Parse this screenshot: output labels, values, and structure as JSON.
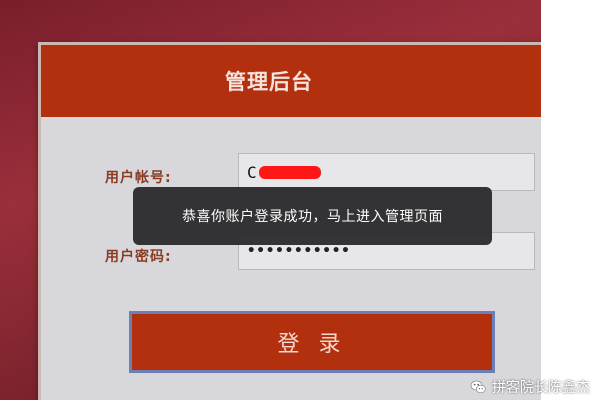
{
  "panel": {
    "title": "管理后台"
  },
  "form": {
    "account_label": "用户帐号:",
    "account_value": "C",
    "password_label": "用户密码:",
    "password_value": "•••••••••••",
    "login_label": "登 录"
  },
  "toast": {
    "message": "恭喜你账户登录成功，马上进入管理页面"
  },
  "watermark": {
    "text": "拼客院长陈鑫杰",
    "icon": "wechat-icon"
  },
  "colors": {
    "brand": "#b3300e",
    "redaction": "#ff1616",
    "toast_bg": "#28282a"
  }
}
